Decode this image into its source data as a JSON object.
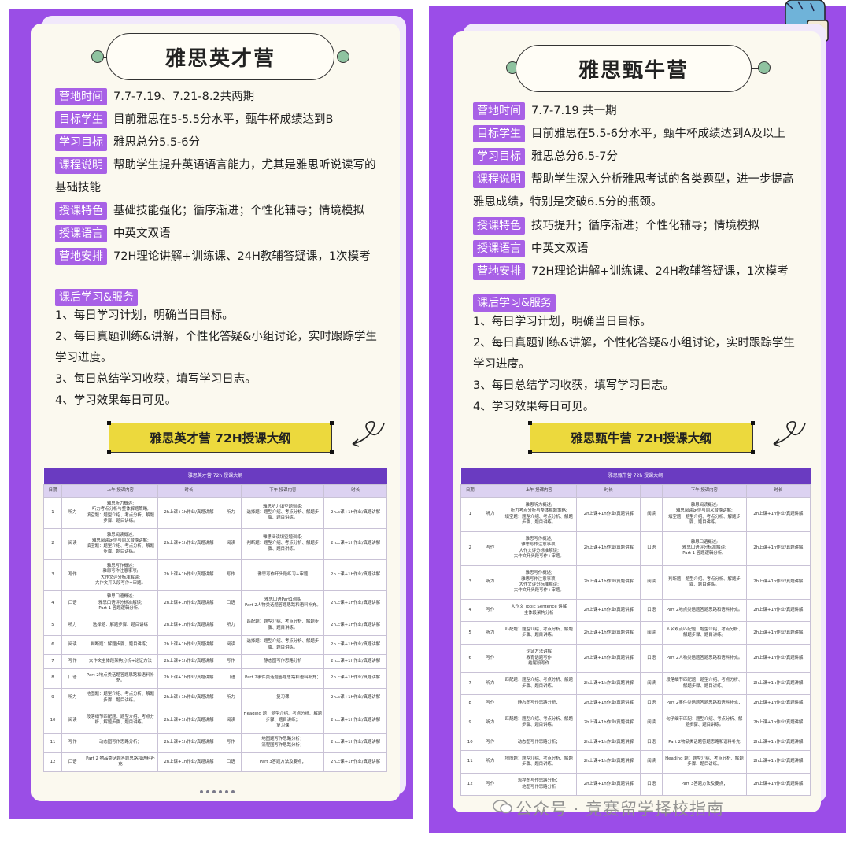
{
  "left": {
    "title": "雅思英才营",
    "items": [
      {
        "label": "营地时间",
        "text": "7.7-7.19、7.21-8.2共两期"
      },
      {
        "label": "目标学生",
        "text": "目前雅思在5-5.5分水平，甄牛杯成绩达到B"
      },
      {
        "label": "学习目标",
        "text": "雅思总分5.5-6分"
      },
      {
        "label": "课程说明",
        "text": "帮助学生提升英语语言能力，尤其是雅思听说读写的",
        "cont": "基础技能"
      },
      {
        "label": "授课特色",
        "text": "基础技能强化；循序渐进；个性化辅导；情境模拟"
      },
      {
        "label": "授课语言",
        "text": "中英文双语"
      },
      {
        "label": "营地安排",
        "text": "72H理论讲解+训练课、24H教辅答疑课，1次模考"
      }
    ],
    "service_label": "课后学习&服务",
    "services": [
      "1、每日学习计划，明确当日目标。",
      "2、每日真题训练&讲解，个性化答疑&小组讨论，实时跟踪学生",
      "学习进度。",
      "3、每日总结学习收获，填写学习日志。",
      "4、学习效果每日可见。"
    ],
    "banner": "雅思英才营 72H授课大纲",
    "table": {
      "caption": "雅思英才营 72h 授课大纲",
      "headers": [
        "日期",
        "",
        "上午 授课内容",
        "时长",
        "",
        "下午 授课内容",
        "时长"
      ],
      "rows": [
        [
          "1",
          "听力",
          "雅思听力概述;\n听力考点分析与整体解题策略;\n填空题：题型介绍、考点分析、解题步骤、题目讲练。",
          "2h上课+1h作业/真题讲解",
          "听力",
          "雅思听力填空题训练;\n选择题：题型介绍、考点分析、解题步骤、题目讲练。",
          "2h上课+1h作业/真题讲解"
        ],
        [
          "2",
          "阅读",
          "雅思阅读概述;\n雅思阅读定位与同义替换讲解;\n填空题：题型介绍、考点分析、解题步骤、题目讲练。",
          "2h上课+1h作业/真题讲解",
          "阅读",
          "雅思阅读填空题训练;\n判断题：题型介绍、考点分析、解题步骤、题目讲练。",
          "2h上课+1h作业/真题讲解"
        ],
        [
          "3",
          "写作",
          "雅思写作概述;\n雅思写作注意事项;\n大作文评分标准解读;\n大作文开头段写作+审题。",
          "2h上课+1h作业/真题讲解",
          "写作",
          "雅思写作开头段练习+审题",
          "2h上课+1h作业/真题讲解"
        ],
        [
          "4",
          "口语",
          "雅思口语概述;\n雅思口语评分标准解读;\nPart 1 答题逻辑分析。",
          "2h上课+1h作业/真题讲解",
          "口语",
          "雅思口语Part1训练\nPart 2人物类话题答题思路和语料补充。",
          "2h上课+1h作业/真题讲解"
        ],
        [
          "5",
          "听力",
          "选择题：解题步骤、题目讲练",
          "2h上课+1h作业/真题讲解",
          "听力",
          "匹配题：题型介绍、考点分析、解题步骤、题目讲练。",
          "2h上课+1h作业/真题讲解"
        ],
        [
          "6",
          "阅读",
          "判断题：解题步骤、题目讲练；",
          "2h上课+1h作业/真题讲解",
          "阅读",
          "选择题：题型介绍、考点分析、解题步骤、题目讲练。",
          "2h上课+1h作业/真题讲解"
        ],
        [
          "7",
          "写作",
          "大作文主体段架构分析+论证方法",
          "2h上课+1h作业/真题讲解",
          "写作",
          "静态图写作思路分析",
          "2h上课+1h作业/真题讲解"
        ],
        [
          "8",
          "口语",
          "Part 2地点类话题答题思路和语料补充。",
          "2h上课+1h作业/真题讲解",
          "口语",
          "Part 2事件类话题答题思路和语料补充；",
          "2h上课+1h作业/真题讲解"
        ],
        [
          "9",
          "听力",
          "地图题：题型介绍、考点分析、解题步骤、题目讲练。",
          "2h上课+1h作业/真题讲解",
          "听力",
          "复习课",
          "2h上课+1h作业/真题讲解"
        ],
        [
          "10",
          "阅读",
          "段落细节匹配题：题型介绍、考点分析、解题步骤、题目讲练。",
          "2h上课+1h作业/真题讲解",
          "阅读",
          "Heading 题：题型介绍、考点分析、解题步骤、题目讲练；\n复习课",
          "2h上课+1h作业/真题讲解"
        ],
        [
          "11",
          "写作",
          "动态图写作思路分析；",
          "2h上课+1h作业/真题讲解",
          "写作",
          "地图题写作思路分析；\n流程图写作思路分析；",
          "2h上课+1h作业/真题讲解"
        ],
        [
          "12",
          "口语",
          "Part 2 物品类话题答题思路和语料补充",
          "2h上课+1h作业/真题讲解",
          "口语",
          "Part 3答题方法及要点；",
          "2h上课+1h作业/真题讲解"
        ]
      ]
    }
  },
  "right": {
    "title": "雅思甄牛营",
    "items": [
      {
        "label": "营地时间",
        "text": "7.7-7.19 共一期"
      },
      {
        "label": "目标学生",
        "text": "目前雅思在5.5-6分水平，甄牛杯成绩达到A及以上"
      },
      {
        "label": "学习目标",
        "text": "雅思总分6.5-7分"
      },
      {
        "label": "课程说明",
        "text": "帮助学生深入分析雅思考试的各类题型，进一步提高",
        "cont": "雅思成绩，特别是突破6.5分的瓶颈。"
      },
      {
        "label": "授课特色",
        "text": "技巧提升；循序渐进；个性化辅导；情境模拟"
      },
      {
        "label": "授课语言",
        "text": "中英文双语"
      },
      {
        "label": "营地安排",
        "text": "72H理论讲解+训练课、24H教辅答疑课，1次模考"
      }
    ],
    "service_label": "课后学习&服务",
    "services": [
      "1、每日学习计划，明确当日目标。",
      "2、每日真题训练&讲解，个性化答疑&小组讨论，实时跟踪学生",
      "学习进度。",
      "3、每日总结学习收获，填写学习日志。",
      "4、学习效果每日可见。"
    ],
    "banner": "雅思甄牛营 72H授课大纲",
    "table": {
      "caption": "雅思甄牛营 72h 授课大纲",
      "headers": [
        "日期",
        "",
        "上午 授课内容",
        "时长",
        "",
        "下午 授课内容",
        "时长"
      ],
      "rows": [
        [
          "1",
          "听力",
          "雅思听力概述;\n听力考点分析与整体解题策略;\n填空题：题型介绍、考点分析、解题步骤、题目讲练。",
          "2h上课+1h作业/真题讲解",
          "阅读",
          "雅思阅读概述;\n雅思阅读定位与同义替换讲解;\n填空题：题型介绍、考点分析、解题步骤、题目讲练。",
          "2h上课+1h作业/真题讲解"
        ],
        [
          "2",
          "写作",
          "雅思写作概述;\n雅思写作注意事项;\n大作文评分标准解读;\n大作文开头段写作+审题。",
          "2h上课+1h作业/真题讲解",
          "口语",
          "雅思口语概述;\n雅思口语评分标准解读;\nPart 1 答题逻辑分析。",
          "2h上课+1h作业/真题讲解"
        ],
        [
          "3",
          "听力",
          "雅思写作概述;\n雅思写作注意事项;\n大作文评分标准解读;\n大作文开头段写作+审题。",
          "2h上课+1h作业/真题讲解",
          "阅读",
          "判断题：题型介绍、考点分析、解题步骤、题目讲练。",
          "2h上课+1h作业/真题讲解"
        ],
        [
          "4",
          "写作",
          "大作文 Topic Sentence 讲解\n主体段架构分析",
          "2h上课+1h作业/真题讲解",
          "口语",
          "Part 2地点类话题答题思路和语料补充。",
          "2h上课+1h作业/真题讲解"
        ],
        [
          "5",
          "听力",
          "匹配题：题型介绍、考点分析、解题步骤、题目讲练。",
          "2h上课+1h作业/真题讲解",
          "阅读",
          "人名观点匹配题：题型介绍、考点分析、解题步骤、题目讲练。",
          "2h上课+1h作业/真题讲解"
        ],
        [
          "6",
          "写作",
          "论证方法讲解\n教育话题写作\n结尾段写作",
          "2h上课+1h作业/真题讲解",
          "口语",
          "Part 2人物类话题答题思路和语料补充。",
          "2h上课+1h作业/真题讲解"
        ],
        [
          "7",
          "听力",
          "匹配题：题型介绍、考点分析、解题步骤、题目讲练。",
          "2h上课+1h作业/真题讲解",
          "阅读",
          "段落细节匹配题：题型介绍、考点分析、解题步骤、题目讲练。",
          "2h上课+1h作业/真题讲解"
        ],
        [
          "8",
          "写作",
          "静态图写作思路分析；",
          "2h上课+1h作业/真题讲解",
          "口语",
          "Part 2事件类话题答题思路和语料补充；",
          "2h上课+1h作业/真题讲解"
        ],
        [
          "9",
          "听力",
          "匹配题：题型介绍、考点分析、解题步骤、题目讲练。",
          "2h上课+1h作业/真题讲解",
          "阅读",
          "句子细节匹配：题型介绍、考点分析、解题步骤、题目讲练。",
          "2h上课+1h作业/真题讲解"
        ],
        [
          "10",
          "写作",
          "动态图写作思路分析；",
          "2h上课+1h作业/真题讲解",
          "口语",
          "Part 2物品类话题答题思路和语料补充",
          "2h上课+1h作业/真题讲解"
        ],
        [
          "11",
          "听力",
          "地图题：题型介绍、考点分析、解题步骤、题目讲练。",
          "2h上课+1h作业/真题讲解",
          "阅读",
          "Heading 题：题型介绍、考点分析、解题步骤、题目讲练。",
          "2h上课+1h作业/真题讲解"
        ],
        [
          "12",
          "写作",
          "流程图写作思路分析；\n地图写作思路分析",
          "2h上课+1h作业/真题讲解",
          "口语",
          "Part 3答题方法及要点；",
          "2h上课+1h作业/真题讲解"
        ]
      ]
    }
  },
  "watermark": "公众号 · 竞赛留学择校指南",
  "colors": {
    "purple": "#9a4ee6",
    "tag": "#a861e6",
    "banner": "#ecd93d",
    "table_header": "#6a3bc1",
    "card": "#fbf9ef"
  }
}
